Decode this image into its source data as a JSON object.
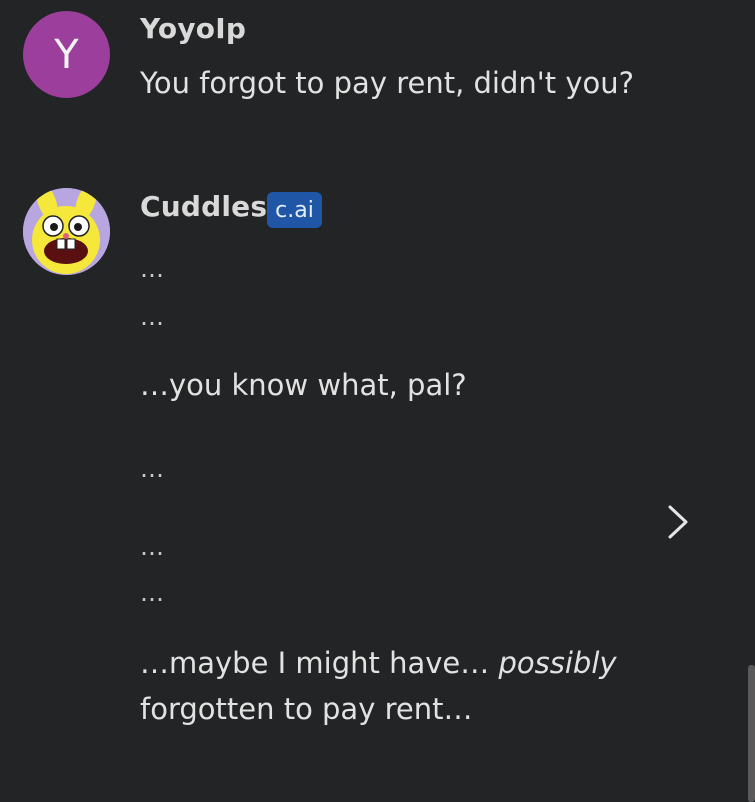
{
  "messages": [
    {
      "author": "YoyoIp",
      "avatar_letter": "Y",
      "avatar_color": "#9c3f9c",
      "text": "You forgot to pay rent, didn't you?"
    },
    {
      "author": "Cuddles",
      "badge": "c.ai",
      "avatar_icon": "cuddles-bunny-avatar",
      "lines": [
        "…",
        "…",
        "…you know what, pal?",
        "…",
        "…",
        "…"
      ],
      "final_line_1_prefix": "…maybe I might have… ",
      "final_line_1_italic": "possibly",
      "final_line_2": "forgotten to pay rent…"
    }
  ],
  "controls": {
    "next_icon": "chevron-right-icon"
  },
  "colors": {
    "background": "#232425",
    "badge": "#1f56a6",
    "text": "#e2e2e2"
  }
}
